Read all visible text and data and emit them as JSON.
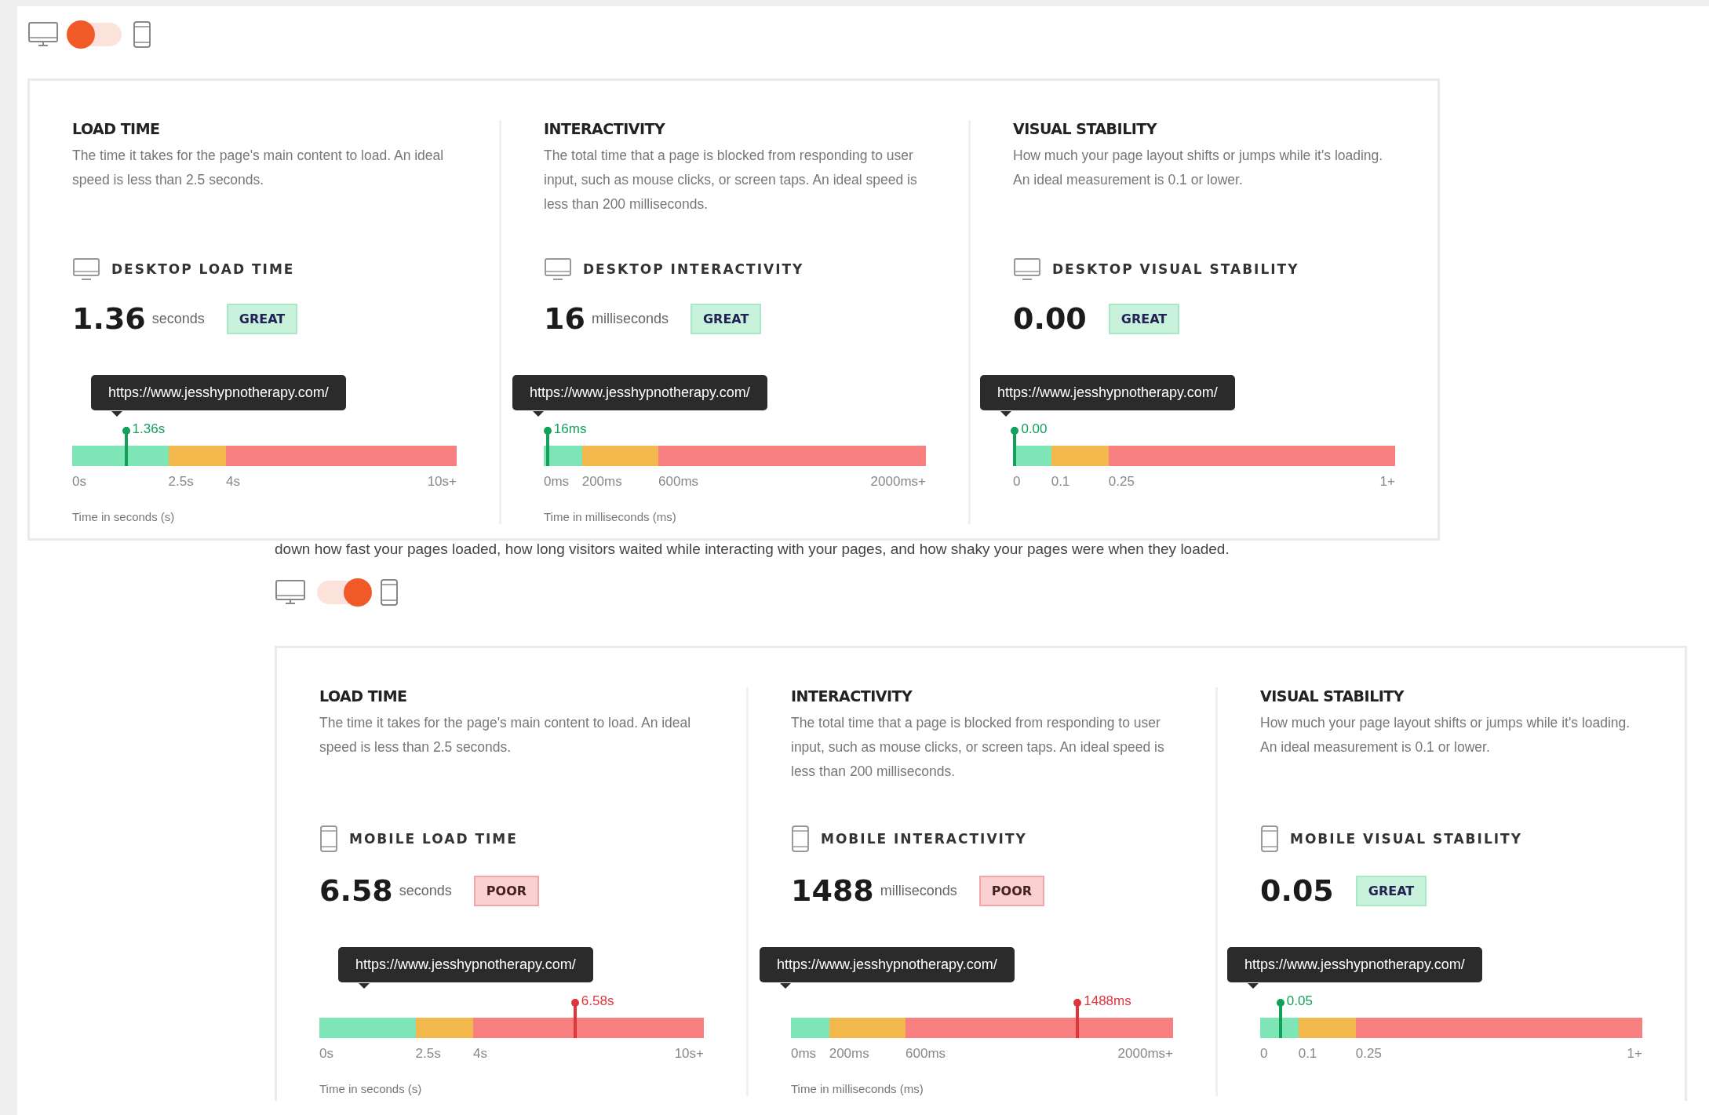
{
  "sections": [
    {
      "kind": "desktop",
      "toggle": {
        "on": false
      },
      "metrics": [
        {
          "kind": "load",
          "title": "LOAD TIME",
          "description": "The time it takes for the page's main content to load. An ideal speed is less than 2.5 seconds.",
          "label": "DESKTOP LOAD TIME",
          "value": "1.36",
          "unit": "seconds",
          "rating": "GREAT",
          "poor": false,
          "tooltip": "https://www.jesshypnotherapy.com/",
          "marker_label": "1.36s",
          "level": 0.14,
          "ticks": [
            "0s",
            "2.5s",
            "4s",
            "10s+"
          ],
          "axis_label": "Time in seconds (s)"
        },
        {
          "kind": "interactivity",
          "title": "INTERACTIVITY",
          "description": "The total time that a page is blocked from responding to user input, such as mouse clicks, or screen taps. An ideal speed is less than 200 milliseconds.",
          "label": "DESKTOP INTERACTIVITY",
          "value": "16",
          "unit": "milliseconds",
          "rating": "GREAT",
          "poor": false,
          "tooltip": "https://www.jesshypnotherapy.com/",
          "marker_label": "16ms",
          "level": 0.01,
          "ticks": [
            "0ms",
            "200ms",
            "600ms",
            "2000ms+"
          ],
          "axis_label": "Time in milliseconds (ms)"
        },
        {
          "kind": "stability",
          "title": "VISUAL STABILITY",
          "description": "How much your page layout shifts or jumps while it's loading. An ideal measurement is 0.1 or lower.",
          "label": "DESKTOP VISUAL STABILITY",
          "value": "0.00",
          "rating": "GREAT",
          "poor": false,
          "tooltip": "https://www.jesshypnotherapy.com/",
          "marker_label": "0.00",
          "level": 0.005,
          "ticks": [
            "0",
            "0.1",
            "0.25",
            "1+"
          ]
        }
      ]
    },
    {
      "kind": "mobile",
      "intro": "down how fast your pages loaded, how long visitors waited while interacting with your pages, and how shaky your pages were when they loaded.",
      "toggle": {
        "on": true
      },
      "metrics": [
        {
          "kind": "load",
          "title": "LOAD TIME",
          "description": "The time it takes for the page's main content to load. An ideal speed is less than 2.5 seconds.",
          "label": "MOBILE LOAD TIME",
          "value": "6.58",
          "unit": "seconds",
          "rating": "POOR",
          "poor": true,
          "tooltip": "https://www.jesshypnotherapy.com/",
          "marker_label": "6.58s",
          "level": 0.665,
          "ticks": [
            "0s",
            "2.5s",
            "4s",
            "10s+"
          ],
          "axis_label": "Time in seconds (s)"
        },
        {
          "kind": "interactivity",
          "title": "INTERACTIVITY",
          "description": "The total time that a page is blocked from responding to user input, such as mouse clicks, or screen taps. An ideal speed is less than 200 milliseconds.",
          "label": "MOBILE INTERACTIVITY",
          "value": "1488",
          "unit": "milliseconds",
          "rating": "POOR",
          "poor": true,
          "tooltip": "https://www.jesshypnotherapy.com/",
          "marker_label": "1488ms",
          "level": 0.75,
          "ticks": [
            "0ms",
            "200ms",
            "600ms",
            "2000ms+"
          ],
          "axis_label": "Time in milliseconds (ms)"
        },
        {
          "kind": "stability",
          "title": "VISUAL STABILITY",
          "description": "How much your page layout shifts or jumps while it's loading. An ideal measurement is 0.1 or lower.",
          "label": "MOBILE VISUAL STABILITY",
          "value": "0.05",
          "rating": "GREAT",
          "poor": false,
          "tooltip": "https://www.jesshypnotherapy.com/",
          "marker_label": "0.05",
          "level": 0.053,
          "ticks": [
            "0",
            "0.1",
            "0.25",
            "1+"
          ]
        }
      ]
    }
  ]
}
